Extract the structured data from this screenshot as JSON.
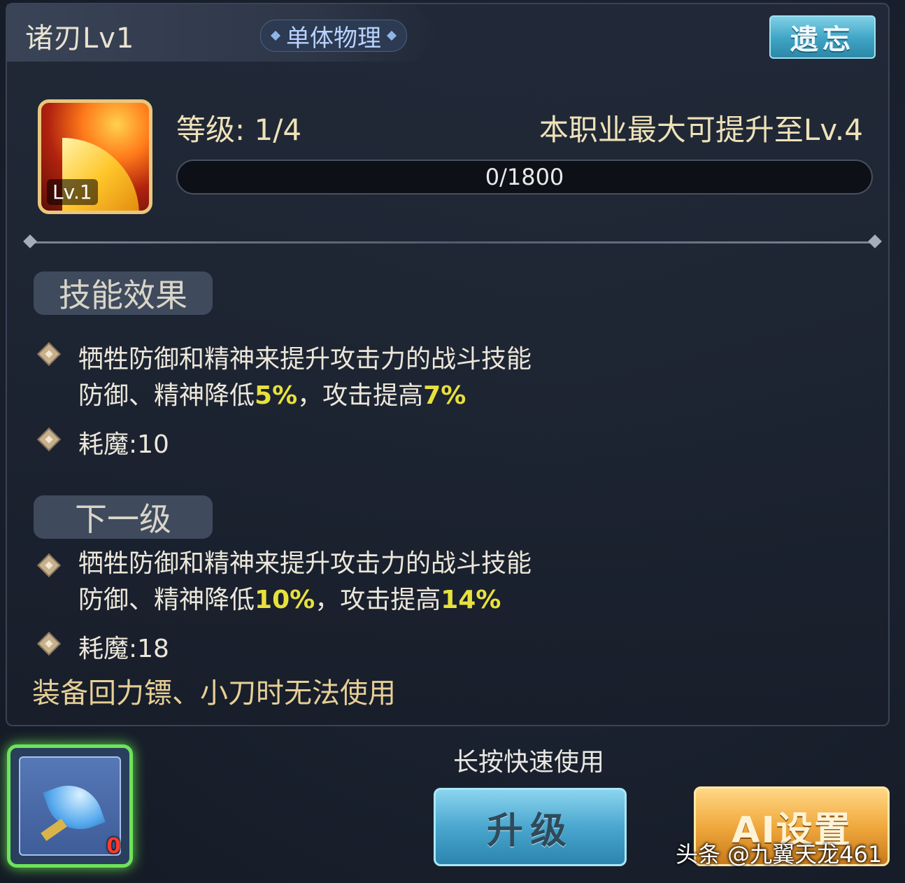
{
  "header": {
    "skill_name": "诸刃Lv1",
    "skill_type": "单体物理",
    "forget_label": "遗忘"
  },
  "skill": {
    "icon": "flame-blade-icon",
    "icon_level": "Lv.1",
    "level_text": "等级: 1/4",
    "max_level_text": "本职业最大可提升至Lv.4",
    "progress_text": "0/1800",
    "progress_fraction": 0
  },
  "effect": {
    "section_label": "技能效果",
    "desc_line1": "牺牲防御和精神来提升攻击力的战斗技能",
    "desc_line2_prefix": "防御、精神降低",
    "desc_line2_val1": "5%",
    "desc_line2_mid": "，攻击提高",
    "desc_line2_val2": "7%",
    "mp_cost": "耗魔:10"
  },
  "next_level": {
    "section_label": "下一级",
    "desc_line1": "牺牲防御和精神来提升攻击力的战斗技能",
    "desc_line2_prefix": "防御、精神降低",
    "desc_line2_val1": "10%",
    "desc_line2_mid": "，攻击提高",
    "desc_line2_val2": "14%",
    "mp_cost": "耗魔:18"
  },
  "restriction": "装备回力镖、小刀时无法使用",
  "footer": {
    "item_icon": "feather-item-icon",
    "item_count": "0",
    "hint": "长按快速使用",
    "upgrade_label": "升级",
    "ai_label": "AI设置"
  },
  "watermark": "头条 @九翼天龙461",
  "colors": {
    "highlight": "#e8e13c",
    "restriction": "#e7cf96",
    "upgrade_button": "#4aa7cf",
    "ai_button": "#f0a93e",
    "forget_button": "#3ea3c4"
  }
}
